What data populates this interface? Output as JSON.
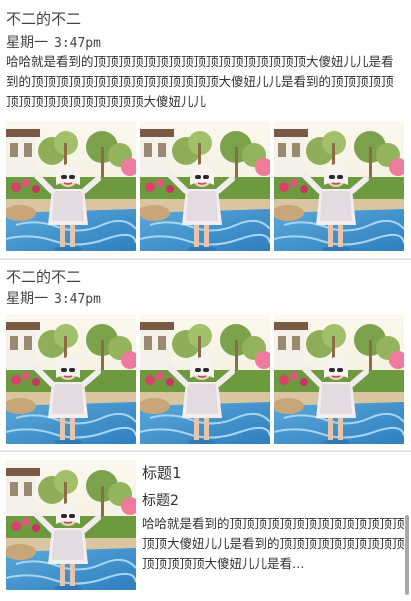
{
  "posts": [
    {
      "author": "不二的不二",
      "day": "星期一",
      "time": "3:47pm",
      "text": "哈哈就是看到的顶顶顶顶顶顶顶顶顶顶顶顶顶顶顶顶顶大傻妞儿儿是看到的顶顶顶顶顶顶顶顶顶顶顶顶顶顶顶大傻妞儿儿是看到的顶顶顶顶顶顶顶顶顶顶顶顶顶顶顶顶大傻妞儿儿",
      "photo_count": 3
    },
    {
      "author": "不二的不二",
      "day": "星期一",
      "time": "3:47pm",
      "photo_count": 3
    }
  ],
  "article": {
    "title1": "标题1",
    "title2": "标题2",
    "desc": "哈哈就是看到的顶顶顶顶顶顶顶顶顶顶顶顶顶顶顶顶大傻妞儿儿是看到的顶顶顶顶顶顶顶顶顶顶顶顶顶顶顶大傻妞儿儿是看…"
  },
  "colors": {
    "text": "#333333",
    "divider": "#e6e6e6",
    "scrollbar": "#a9a9a9"
  }
}
